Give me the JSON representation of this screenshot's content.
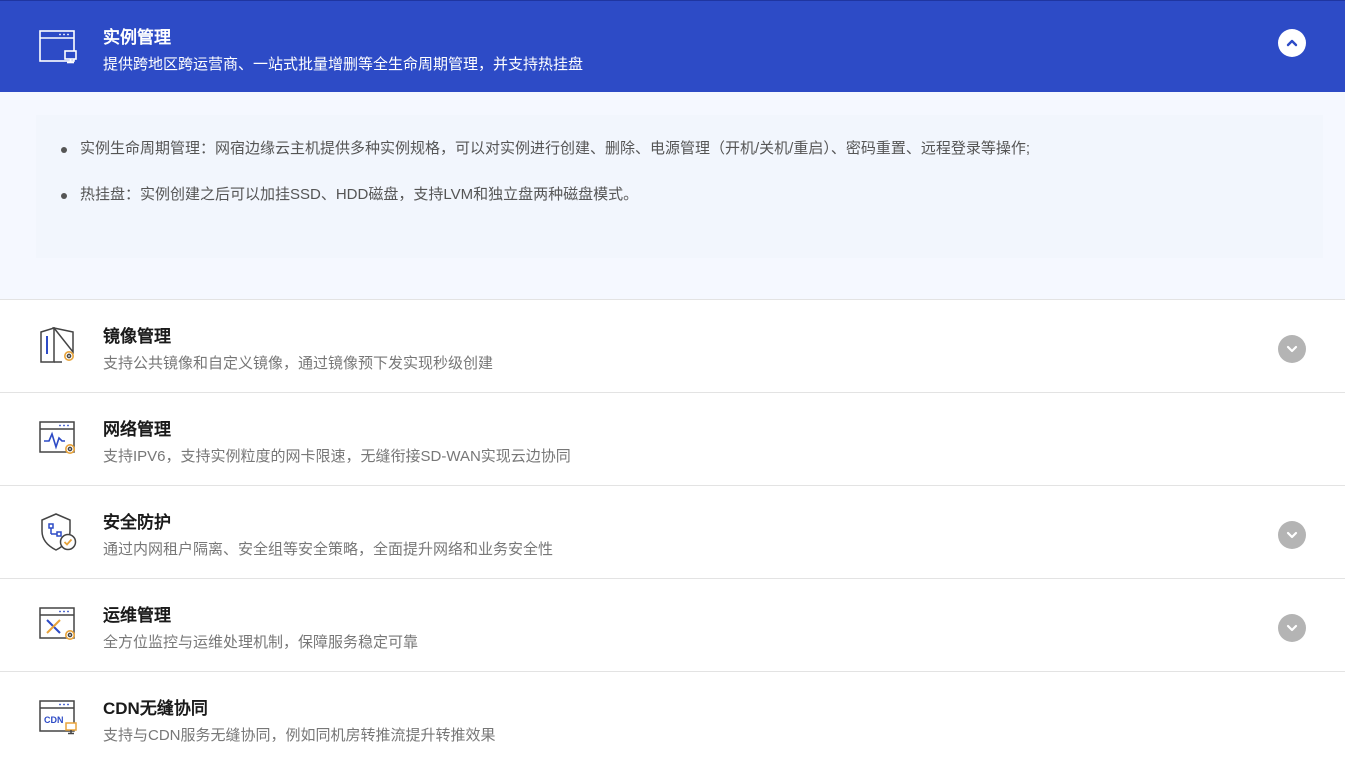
{
  "colors": {
    "accent": "#2d4bc6",
    "toggle_gray": "#b4b4b4"
  },
  "items": [
    {
      "title": "实例管理",
      "desc": "提供跨地区跨运营商、一站式批量增删等全生命周期管理，并支持热挂盘",
      "icon": "instance-window-icon",
      "expanded": true,
      "toggle": "chevron-up-icon",
      "details": [
        "实例生命周期管理：网宿边缘云主机提供多种实例规格，可以对实例进行创建、删除、电源管理（开机/关机/重启）、密码重置、远程登录等操作;",
        "热挂盘：实例创建之后可以加挂SSD、HDD磁盘，支持LVM和独立盘两种磁盘模式。"
      ]
    },
    {
      "title": "镜像管理",
      "desc": "支持公共镜像和自定义镜像，通过镜像预下发实现秒级创建",
      "icon": "image-gear-icon",
      "expanded": false,
      "toggle": "chevron-down-icon"
    },
    {
      "title": "网络管理",
      "desc": "支持IPV6，支持实例粒度的网卡限速，无缝衔接SD-WAN实现云边协同",
      "icon": "network-gear-icon",
      "expanded": false,
      "toggle": "none"
    },
    {
      "title": "安全防护",
      "desc": "通过内网租户隔离、安全组等安全策略，全面提升网络和业务安全性",
      "icon": "shield-check-icon",
      "expanded": false,
      "toggle": "chevron-down-icon"
    },
    {
      "title": "运维管理",
      "desc": "全方位监控与运维处理机制，保障服务稳定可靠",
      "icon": "tools-gear-icon",
      "expanded": false,
      "toggle": "chevron-down-icon"
    },
    {
      "title": "CDN无缝协同",
      "desc": "支持与CDN服务无缝协同，例如同机房转推流提升转推效果",
      "icon": "cdn-window-icon",
      "expanded": false,
      "toggle": "none",
      "icon_text": "CDN"
    }
  ]
}
